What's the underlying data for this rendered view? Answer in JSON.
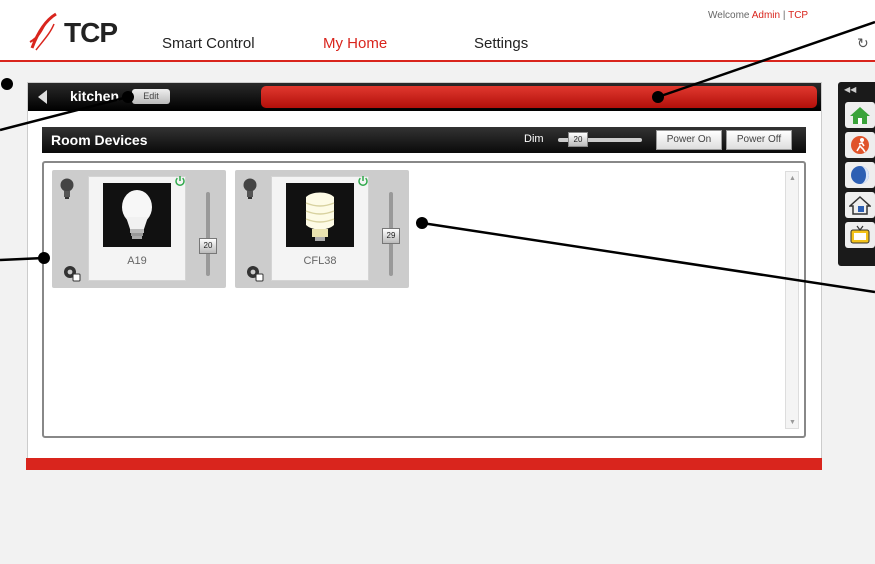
{
  "header": {
    "logo_text": "TCP",
    "nav": {
      "smart_control": "Smart Control",
      "my_home": "My Home",
      "settings": "Settings"
    },
    "welcome_prefix": "Welcome",
    "welcome_user": "Admin",
    "welcome_separator": "|",
    "welcome_brand": "TCP"
  },
  "room": {
    "name": "kitchen",
    "edit_label": "Edit"
  },
  "devices_panel": {
    "title": "Room Devices",
    "dim_label": "Dim",
    "dim_value": "20",
    "power_on_label": "Power On",
    "power_off_label": "Power Off"
  },
  "devices": [
    {
      "name": "A19",
      "level": "20",
      "powered": true
    },
    {
      "name": "CFL38",
      "level": "29",
      "powered": true
    }
  ],
  "colors": {
    "accent_red": "#d9251d",
    "bar_black": "#111111",
    "power_green": "#2ea84a"
  },
  "icons": {
    "header": [
      "tcp-logo-icon",
      "refresh-icon"
    ],
    "dock": [
      "home-icon",
      "away-icon",
      "night-icon",
      "house-lock-icon",
      "tv-icon"
    ],
    "device": [
      "bulb-icon",
      "power-icon",
      "gear-icon"
    ]
  }
}
